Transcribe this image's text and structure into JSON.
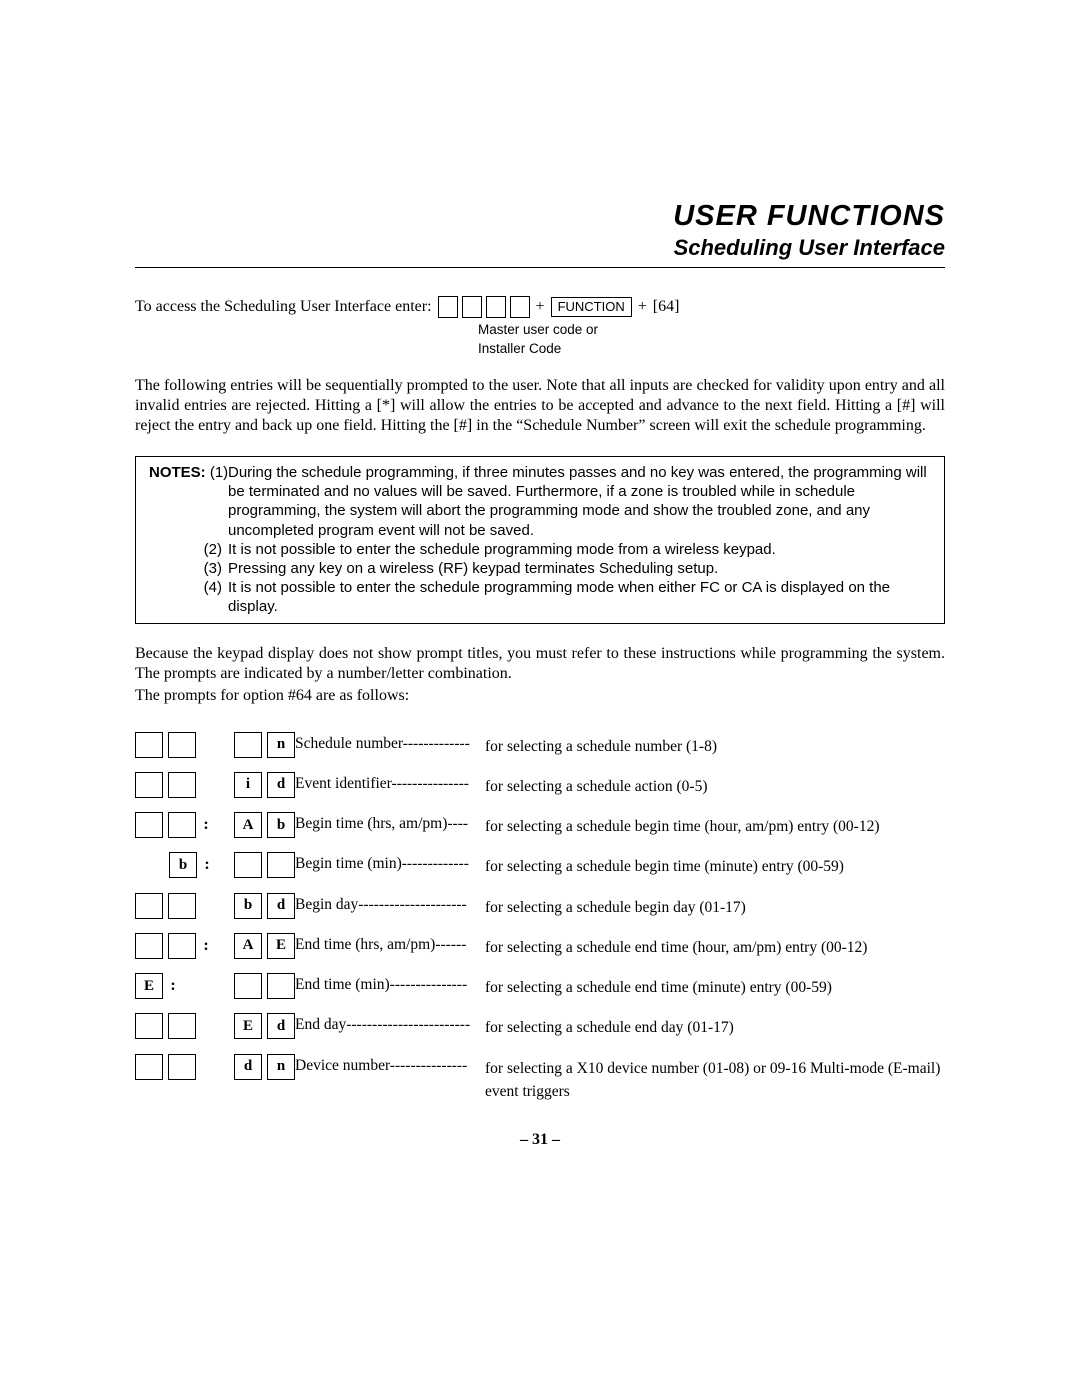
{
  "header": {
    "title": "USER FUNCTIONS",
    "subtitle": "Scheduling User Interface"
  },
  "access": {
    "prefix_text": "To access the Scheduling User Interface enter:",
    "plus1": "+",
    "function_key": "FUNCTION",
    "plus2": "+",
    "code": "[64]",
    "caption_line1": "Master user code or",
    "caption_line2": "Installer Code"
  },
  "para1": "The following entries will be sequentially prompted to the user. Note that all inputs are checked for validity upon entry and all invalid entries are rejected. Hitting a [*] will allow the entries to be accepted and advance to the next field. Hitting a [#] will reject the entry and back up one field. Hitting the [#] in the “Schedule Number” screen will exit the schedule programming.",
  "notes": {
    "label": "NOTES:",
    "items": [
      {
        "num": "(1)",
        "text": "During the schedule programming, if three minutes passes and no key was entered, the programming will be terminated and no values will be saved. Furthermore, if a zone is troubled while in schedule programming, the system will abort the programming mode and show the troubled zone, and any uncompleted program event will not be saved."
      },
      {
        "num": "(2)",
        "text": "It is not possible to enter the schedule programming mode from a wireless keypad."
      },
      {
        "num": "(3)",
        "text": "Pressing any key on a wireless (RF) keypad terminates Scheduling setup."
      },
      {
        "num": "(4)",
        "text": "It is not possible to enter the schedule programming mode when either FC or CA is displayed on the display."
      }
    ]
  },
  "para2": "Because the keypad display does not show prompt titles, you must refer to these instructions while programming the system. The prompts are indicated by a number/letter combination.",
  "para3": "The prompts for option #64 are as follows:",
  "prompts": [
    {
      "layout": "four_right",
      "cells": [
        "",
        "",
        "",
        "n"
      ],
      "label": "Schedule number-------------",
      "desc": "for selecting a schedule number (1-8)"
    },
    {
      "layout": "four_right",
      "cells": [
        "",
        "",
        "i",
        "d"
      ],
      "label": "Event identifier---------------",
      "desc": "for selecting a schedule action (0-5)"
    },
    {
      "layout": "two_colon_two",
      "cells": [
        "",
        "",
        "A",
        "b"
      ],
      "label": "Begin time (hrs, am/pm)----",
      "desc": "for selecting a schedule begin time (hour, am/pm) entry (00-12)"
    },
    {
      "layout": "one_colon_two_shift",
      "cells": [
        "b",
        "",
        ""
      ],
      "label": "Begin time (min)-------------",
      "desc": "for selecting a schedule begin time (minute) entry (00-59)"
    },
    {
      "layout": "four_right",
      "cells": [
        "",
        "",
        "b",
        "d"
      ],
      "label": "Begin day---------------------",
      "desc": "for selecting a schedule begin day (01-17)"
    },
    {
      "layout": "two_colon_two",
      "cells": [
        "",
        "",
        "A",
        "E"
      ],
      "label": "End time (hrs, am/pm)------",
      "desc": "for selecting a schedule end time (hour, am/pm) entry (00-12)"
    },
    {
      "layout": "one_colon_two_far_left",
      "cells": [
        "E",
        "",
        ""
      ],
      "label": "End time (min)---------------",
      "desc": "for selecting a schedule end time (minute) entry (00-59)"
    },
    {
      "layout": "four_right",
      "cells": [
        "",
        "",
        "E",
        "d"
      ],
      "label": "End day------------------------",
      "desc": "for selecting a schedule end day (01-17)"
    },
    {
      "layout": "four_right",
      "cells": [
        "",
        "",
        "d",
        "n"
      ],
      "label": "Device number---------------",
      "desc": "for selecting a X10 device number (01-08) or 09-16 Multi-mode (E-mail) event triggers"
    }
  ],
  "page_number": "– 31 –"
}
